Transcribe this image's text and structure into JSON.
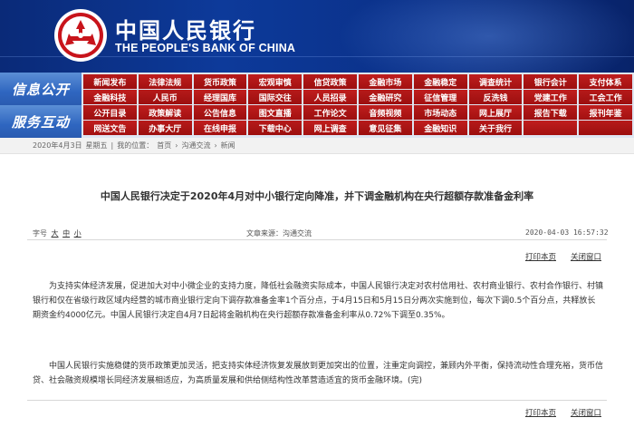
{
  "header": {
    "brand_cn": "中国人民银行",
    "brand_en": "THE PEOPLE'S BANK OF CHINA",
    "logo_icon": "pboc-logo-icon"
  },
  "nav": {
    "section1_label": "信息公开",
    "section2_label": "服务互动",
    "rows": [
      [
        "新闻发布",
        "法律法规",
        "货币政策",
        "宏观审慎",
        "信贷政策",
        "金融市场",
        "金融稳定",
        "调查统计",
        "银行会计",
        "支付体系"
      ],
      [
        "金融科技",
        "人民币",
        "经理国库",
        "国际交往",
        "人员招录",
        "金融研究",
        "征信管理",
        "反洗钱",
        "党建工作",
        "工会工作"
      ],
      [
        "公开目录",
        "政策解读",
        "公告信息",
        "图文直播",
        "工作论文",
        "音频视频",
        "市场动态",
        "网上展厅",
        "报告下载",
        "报刊年鉴"
      ],
      [
        "网送文告",
        "办事大厅",
        "在线申报",
        "下载中心",
        "网上调查",
        "意见征集",
        "金融知识",
        "关于我行",
        "",
        ""
      ]
    ]
  },
  "breadcrumb": {
    "date": "2020年4月3日",
    "weekday": "星期五",
    "prefix": "我的位置：",
    "home": "首页",
    "sep": "›",
    "level1": "沟通交流",
    "level2": "新闻"
  },
  "article": {
    "title": "中国人民银行决定于2020年4月对中小银行定向降准，并下调金融机构在央行超额存款准备金利率",
    "font_label": "字号",
    "size_large": "大",
    "size_medium": "中",
    "size_small": "小",
    "source": "文章来源：沟通交流",
    "datetime": "2020-04-03  16:57:32",
    "print_label": "打印本页",
    "close_label": "关闭窗口",
    "paragraphs": [
      "为支持实体经济发展，促进加大对中小微企业的支持力度，降低社会融资实际成本，中国人民银行决定对农村信用社、农村商业银行、农村合作银行、村镇银行和仅在省级行政区域内经营的城市商业银行定向下调存款准备金率1个百分点，于4月15日和5月15日分两次实施到位，每次下调0.5个百分点，共释放长期资金约4000亿元。中国人民银行决定自4月7日起将金融机构在央行超额存款准备金利率从0.72%下调至0.35%。",
      "中国人民银行实施稳健的货币政策更加灵活，把支持实体经济恢复发展放到更加突出的位置，注重定向调控，兼顾内外平衡，保持流动性合理充裕，货币信贷、社会融资规模增长同经济发展相适应，为高质量发展和供给侧结构性改革营造适宜的货币金融环境。(完)"
    ]
  },
  "colors": {
    "banner_blue": "#0d3a9a",
    "nav_red": "#b61a1a",
    "nav_side_blue": "#2f66c0"
  }
}
